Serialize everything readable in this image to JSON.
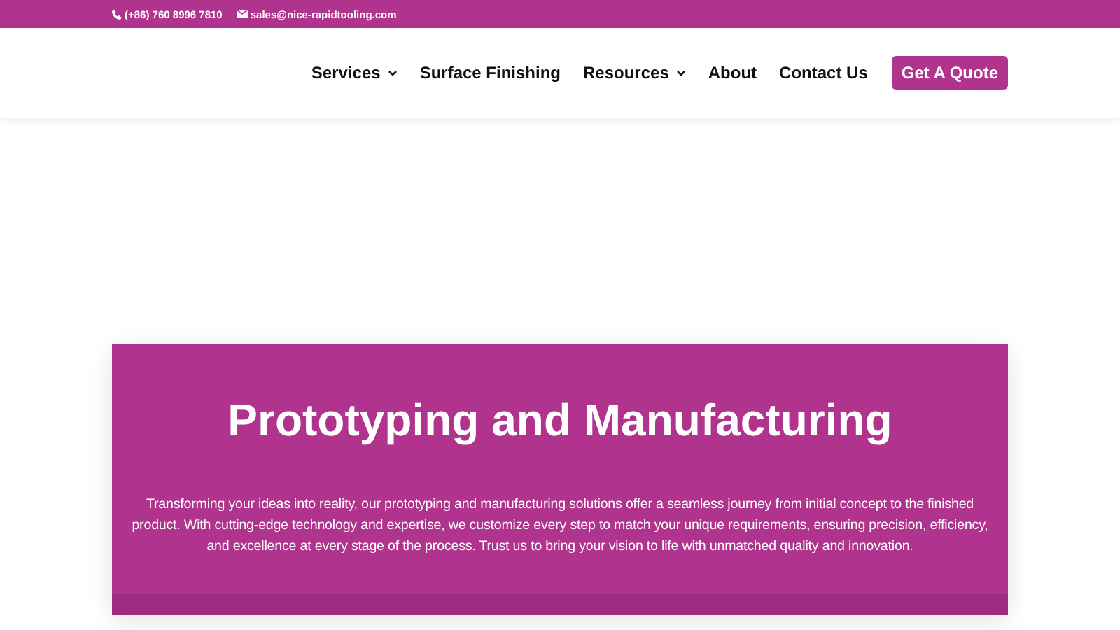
{
  "top_bar": {
    "phone": "(+86) 760 8996 7810",
    "email": "sales@nice-rapidtooling.com"
  },
  "nav": {
    "items": [
      {
        "label": "Services",
        "has_menu": true
      },
      {
        "label": "Surface Finishing",
        "has_menu": false
      },
      {
        "label": "Resources",
        "has_menu": true
      },
      {
        "label": "About",
        "has_menu": false
      },
      {
        "label": "Contact Us",
        "has_menu": false
      }
    ],
    "cta": "Get A Quote"
  },
  "hero": {
    "title": "Prototyping and Manufacturing",
    "text": "Transforming your ideas into reality, our prototyping and manufacturing solutions offer a seamless journey from initial concept to the finished product. With cutting-edge technology and expertise, we customize every step to match your unique requirements, ensuring precision, efficiency, and excellence at every stage of the process. Trust us to bring your vision to life with unmatched quality and innovation."
  }
}
